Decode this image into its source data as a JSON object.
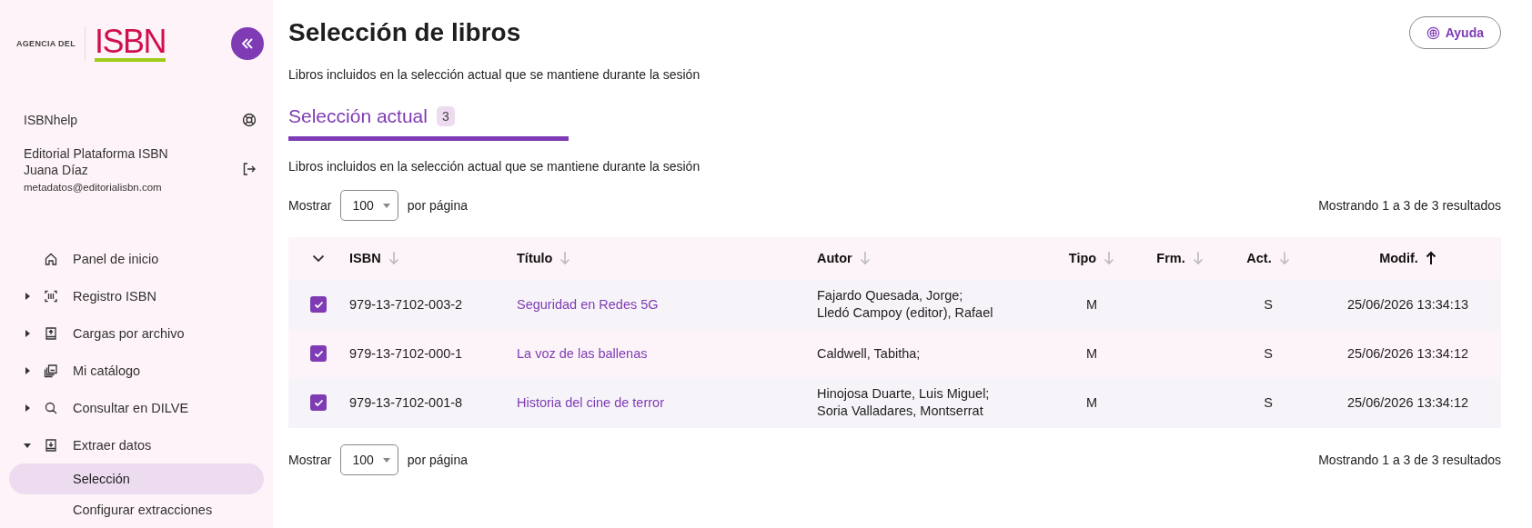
{
  "sidebar": {
    "logo": {
      "prefix": "AGENCIA DEL",
      "mark": "ISBN"
    },
    "help_link": "ISBNhelp",
    "user": {
      "publisher": "Editorial Plataforma ISBN",
      "name": "Juana Díaz",
      "email": "metadatos@editorialisbn.com"
    },
    "nav": [
      {
        "label": "Panel de inicio",
        "kind": "link"
      },
      {
        "label": "Registro ISBN",
        "kind": "group",
        "expanded": false
      },
      {
        "label": "Cargas por archivo",
        "kind": "group",
        "expanded": false
      },
      {
        "label": "Mi catálogo",
        "kind": "group",
        "expanded": false
      },
      {
        "label": "Consultar en DILVE",
        "kind": "group",
        "expanded": false
      },
      {
        "label": "Extraer datos",
        "kind": "group",
        "expanded": true,
        "children": [
          {
            "label": "Selección",
            "selected": true
          },
          {
            "label": "Configurar extracciones",
            "selected": false
          }
        ]
      }
    ]
  },
  "page": {
    "title": "Selección de libros",
    "help_button": "Ayuda",
    "subtitle": "Libros incluidos en la selección actual que se mantiene durante la sesión"
  },
  "tabs": [
    {
      "label": "Selección actual",
      "count": "3",
      "selected": true
    }
  ],
  "tab_description": "Libros incluidos en la selección actual que se mantiene durante la sesión",
  "pager_top": {
    "before": "Mostrar",
    "value": "100",
    "after": "por página",
    "summary": "Mostrando 1 a 3 de 3 resultados"
  },
  "table": {
    "columns": [
      {
        "label": "ISBN",
        "sorted": false
      },
      {
        "label": "Título",
        "sorted": false
      },
      {
        "label": "Autor",
        "sorted": false
      },
      {
        "label": "Tipo",
        "sorted": false
      },
      {
        "label": "Frm.",
        "sorted": false
      },
      {
        "label": "Act.",
        "sorted": false
      },
      {
        "label": "Modif.",
        "sorted": true
      }
    ],
    "rows": [
      {
        "checked": true,
        "isbn": "979-13-7102-003-2",
        "title": "Seguridad en Redes 5G",
        "author": [
          "Fajardo Quesada, Jorge;",
          "Lledó Campoy (editor), Rafael"
        ],
        "tipo": "M",
        "act": "S",
        "modif": "25/06/2026 13:34:13"
      },
      {
        "checked": true,
        "isbn": "979-13-7102-000-1",
        "title": "La voz de las ballenas",
        "author": [
          "Caldwell, Tabitha;"
        ],
        "tipo": "M",
        "act": "S",
        "modif": "25/06/2026 13:34:12"
      },
      {
        "checked": true,
        "isbn": "979-13-7102-001-8",
        "title": "Historia del cine de terror",
        "author": [
          "Hinojosa Duarte, Luis Miguel;",
          "Soria Valladares, Montserrat"
        ],
        "tipo": "M",
        "act": "S",
        "modif": "25/06/2026 13:34:12"
      }
    ]
  },
  "pager_bottom": {
    "before": "Mostrar",
    "value": "100",
    "after": "por página",
    "summary": "Mostrando 1 a 3 de 3 resultados"
  }
}
